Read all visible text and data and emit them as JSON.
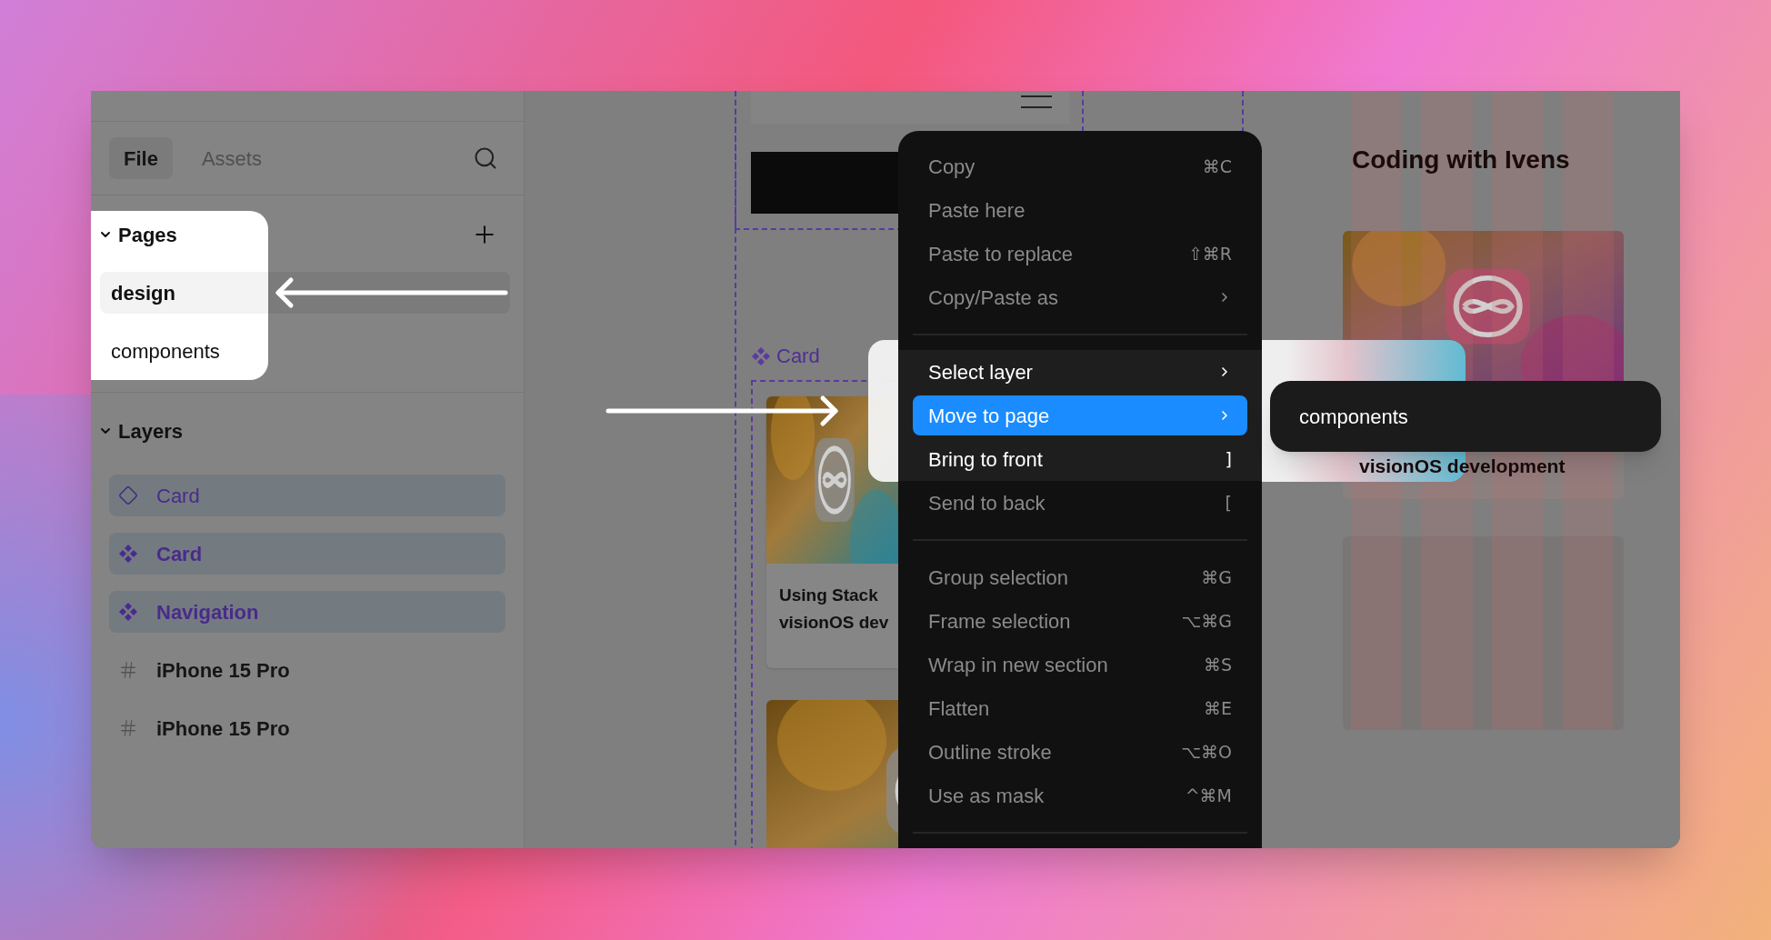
{
  "sidebar": {
    "tabs": [
      {
        "label": "File",
        "selected": true
      },
      {
        "label": "Assets",
        "selected": false
      }
    ],
    "pages": {
      "title": "Pages",
      "expanded": true,
      "items": [
        {
          "label": "design",
          "selected": true
        },
        {
          "label": "components",
          "selected": false
        }
      ]
    },
    "layers": {
      "title": "Layers",
      "expanded": true,
      "items": [
        {
          "label": "Card",
          "kind": "instance",
          "selected": true
        },
        {
          "label": "Card",
          "kind": "component",
          "selected": true
        },
        {
          "label": "Navigation",
          "kind": "component",
          "selected": true
        },
        {
          "label": "iPhone 15 Pro",
          "kind": "frame",
          "selected": false
        },
        {
          "label": "iPhone 15 Pro",
          "kind": "frame",
          "selected": false
        }
      ]
    }
  },
  "canvas": {
    "left_frame": {
      "component_label": "Card",
      "card_title_lines": [
        "Using Stack",
        "visionOS dev"
      ]
    },
    "right_frame": {
      "title": "Coding with Ivens",
      "card_title": "visionOS development"
    }
  },
  "context_menu": {
    "groups": [
      {
        "items": [
          {
            "label": "Copy",
            "shortcut": "⌘C",
            "has_submenu": false,
            "emphasized": false,
            "selected": false
          },
          {
            "label": "Paste here",
            "has_submenu": false,
            "emphasized": false,
            "selected": false
          },
          {
            "label": "Paste to replace",
            "shortcut": "⇧⌘R",
            "has_submenu": false,
            "emphasized": false,
            "selected": false
          },
          {
            "label": "Copy/Paste as",
            "has_submenu": true,
            "emphasized": false,
            "selected": false
          }
        ]
      },
      {
        "items": [
          {
            "label": "Select layer",
            "has_submenu": true,
            "emphasized": true,
            "selected": false
          },
          {
            "label": "Move to page",
            "has_submenu": true,
            "emphasized": true,
            "selected": true
          },
          {
            "label": "Bring to front",
            "shortcut": "]",
            "has_submenu": false,
            "emphasized": true,
            "selected": false
          },
          {
            "label": "Send to back",
            "shortcut": "[",
            "has_submenu": false,
            "emphasized": false,
            "selected": false
          }
        ]
      },
      {
        "items": [
          {
            "label": "Group selection",
            "shortcut": "⌘G",
            "has_submenu": false,
            "emphasized": false,
            "selected": false
          },
          {
            "label": "Frame selection",
            "shortcut": "⌥⌘G",
            "has_submenu": false,
            "emphasized": false,
            "selected": false
          },
          {
            "label": "Wrap in new section",
            "shortcut": "⌘S",
            "has_submenu": false,
            "emphasized": false,
            "selected": false
          },
          {
            "label": "Flatten",
            "shortcut": "⌘E",
            "has_submenu": false,
            "emphasized": false,
            "selected": false
          },
          {
            "label": "Outline stroke",
            "shortcut": "⌥⌘O",
            "has_submenu": false,
            "emphasized": false,
            "selected": false
          },
          {
            "label": "Use as mask",
            "shortcut": "^⌘M",
            "has_submenu": false,
            "emphasized": false,
            "selected": false
          }
        ]
      }
    ]
  },
  "submenu": {
    "items": [
      {
        "label": "components"
      }
    ]
  }
}
